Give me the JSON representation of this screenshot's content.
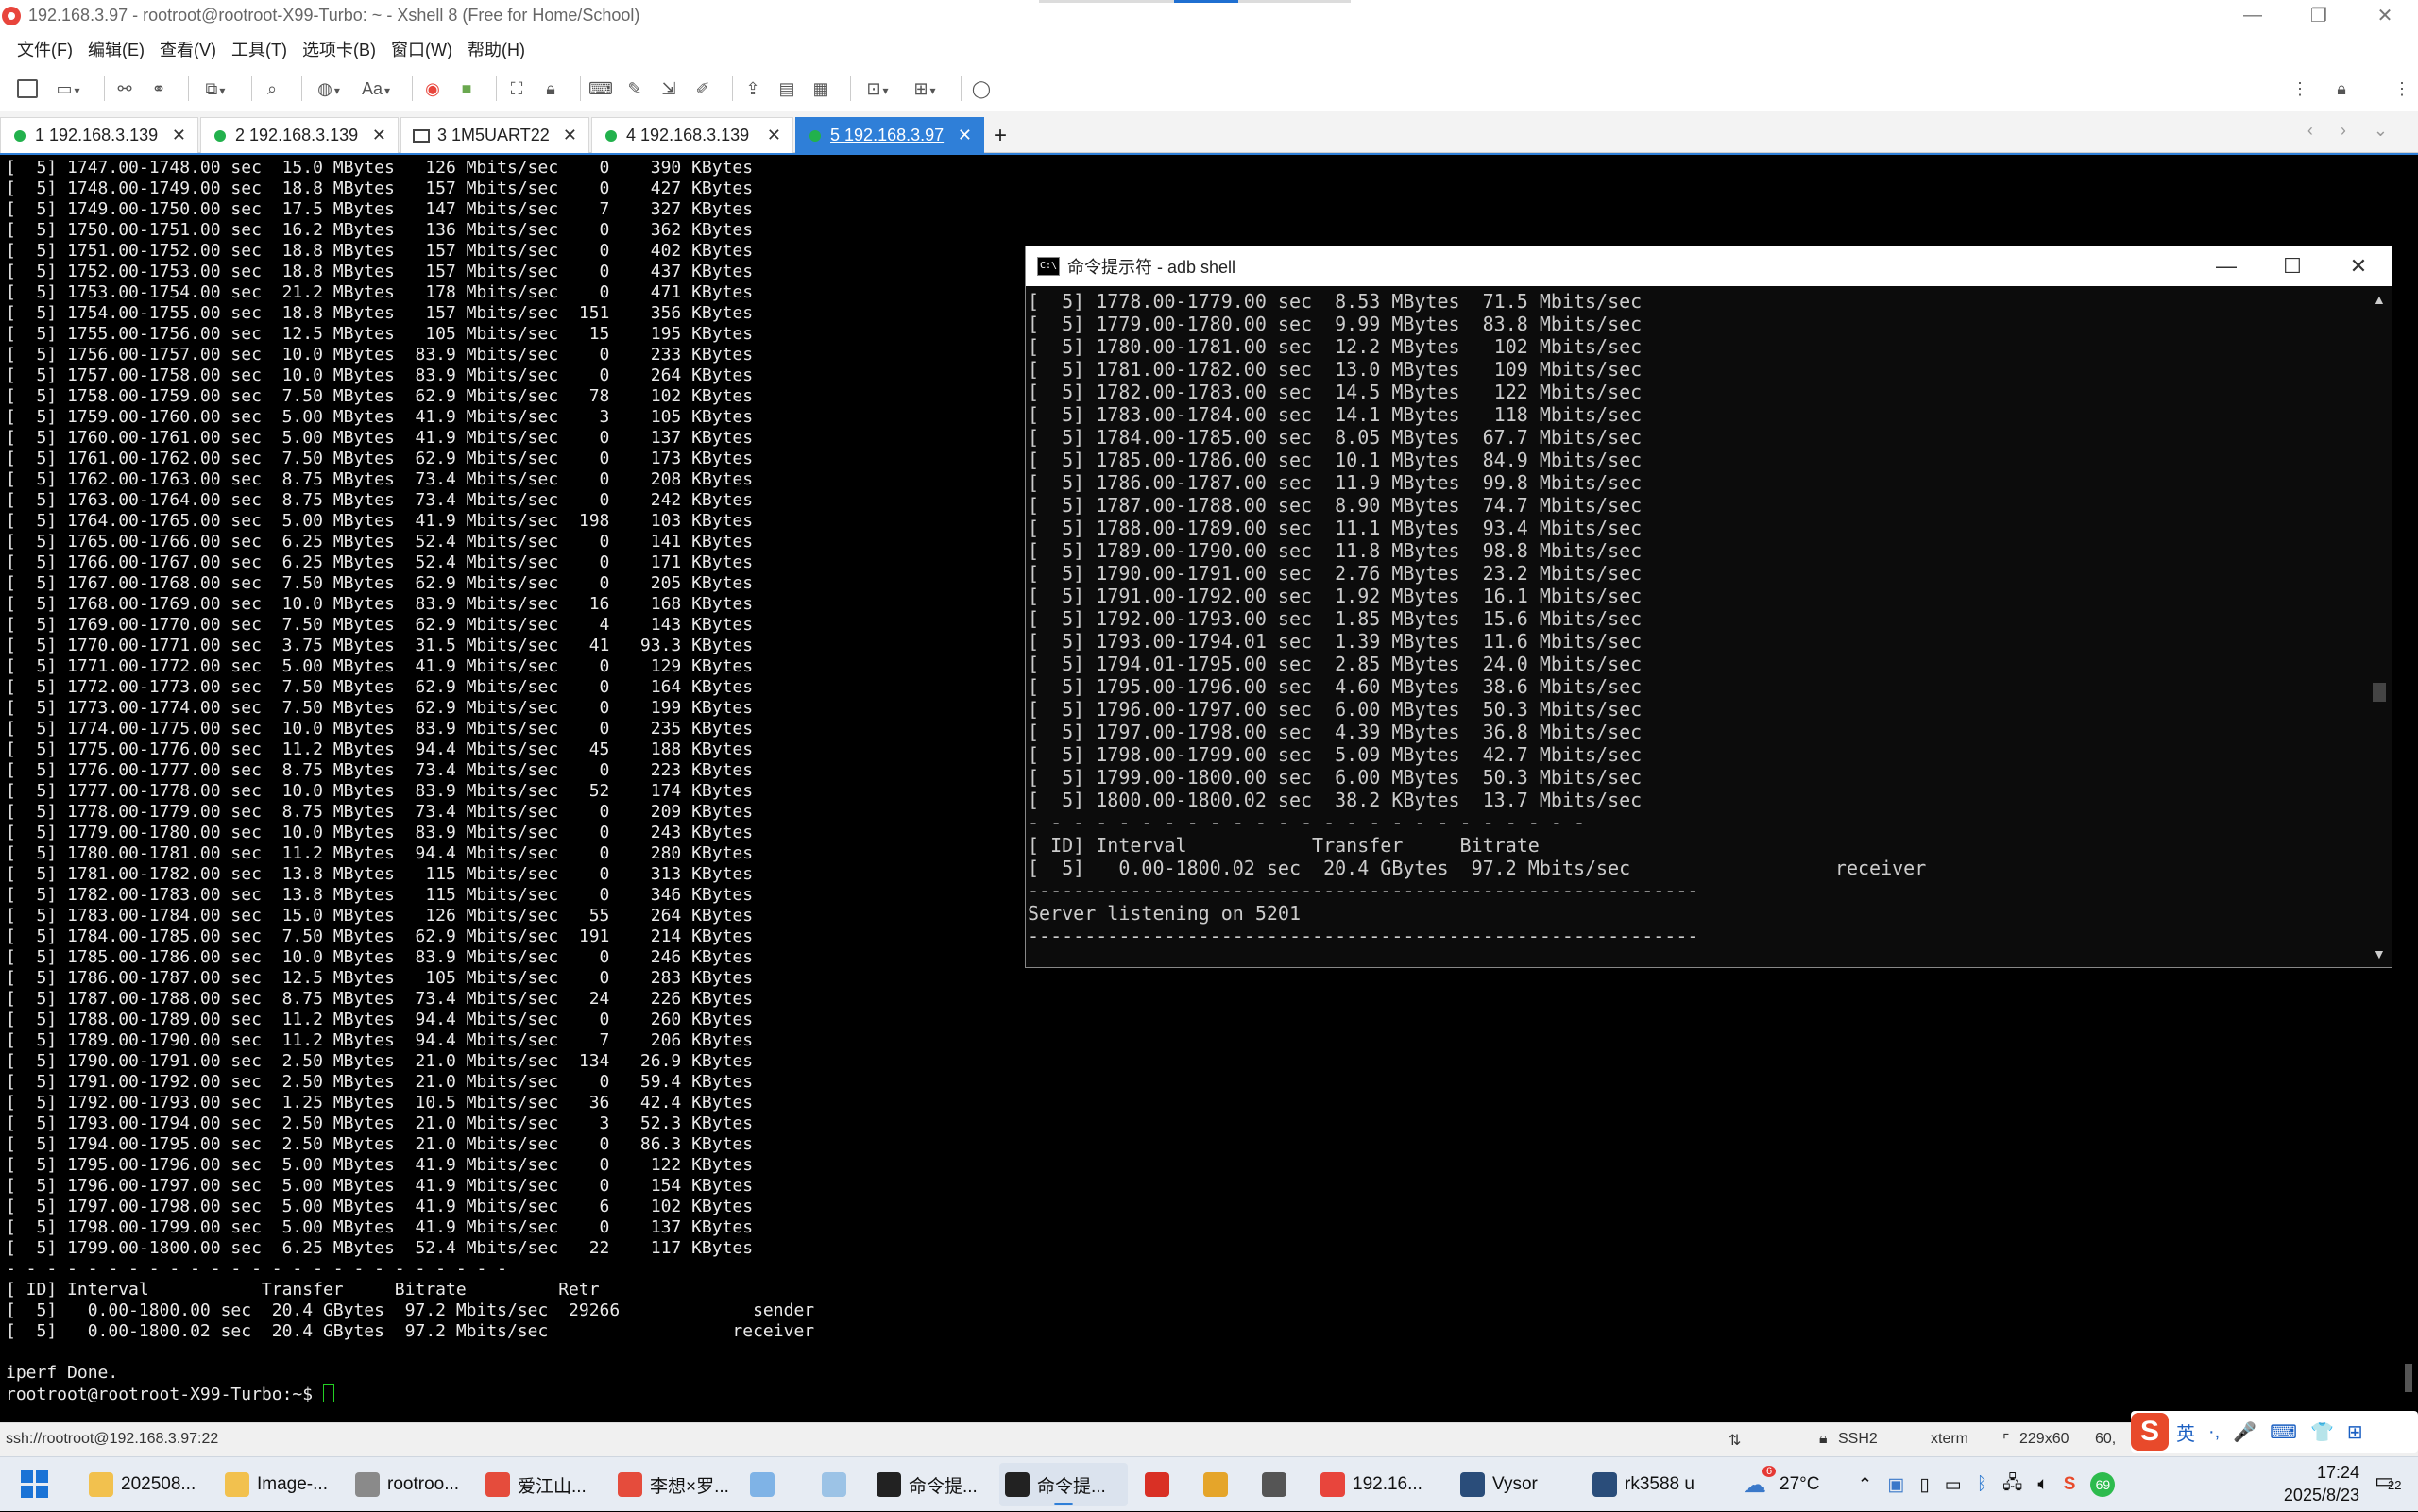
{
  "window": {
    "title": "192.168.3.97 - rootroot@rootroot-X99-Turbo: ~ - Xshell 8 (Free for Home/School)",
    "controls": [
      "—",
      "❐",
      "✕"
    ]
  },
  "menu": [
    "文件(F)",
    "编辑(E)",
    "查看(V)",
    "工具(T)",
    "选项卡(B)",
    "窗口(W)",
    "帮助(H)"
  ],
  "tabs": [
    {
      "num": "1",
      "label": "192.168.3.139",
      "icon": "green-dot"
    },
    {
      "num": "2",
      "label": "192.168.3.139",
      "icon": "green-dot"
    },
    {
      "num": "3",
      "label": "1M5UART22",
      "icon": "keyboard-icon"
    },
    {
      "num": "4",
      "label": "192.168.3.139",
      "icon": "green-dot"
    },
    {
      "num": "5",
      "label": "192.168.3.97",
      "icon": "green-dot",
      "active": true
    }
  ],
  "tab_close": "✕",
  "tab_add": "+",
  "tab_nav": "‹ › ⌄",
  "terminal": {
    "lines": [
      "[  5] 1747.00-1748.00 sec  15.0 MBytes   126 Mbits/sec    0    390 KBytes",
      "[  5] 1748.00-1749.00 sec  18.8 MBytes   157 Mbits/sec    0    427 KBytes",
      "[  5] 1749.00-1750.00 sec  17.5 MBytes   147 Mbits/sec    7    327 KBytes",
      "[  5] 1750.00-1751.00 sec  16.2 MBytes   136 Mbits/sec    0    362 KBytes",
      "[  5] 1751.00-1752.00 sec  18.8 MBytes   157 Mbits/sec    0    402 KBytes",
      "[  5] 1752.00-1753.00 sec  18.8 MBytes   157 Mbits/sec    0    437 KBytes",
      "[  5] 1753.00-1754.00 sec  21.2 MBytes   178 Mbits/sec    0    471 KBytes",
      "[  5] 1754.00-1755.00 sec  18.8 MBytes   157 Mbits/sec  151    356 KBytes",
      "[  5] 1755.00-1756.00 sec  12.5 MBytes   105 Mbits/sec   15    195 KBytes",
      "[  5] 1756.00-1757.00 sec  10.0 MBytes  83.9 Mbits/sec    0    233 KBytes",
      "[  5] 1757.00-1758.00 sec  10.0 MBytes  83.9 Mbits/sec    0    264 KBytes",
      "[  5] 1758.00-1759.00 sec  7.50 MBytes  62.9 Mbits/sec   78    102 KBytes",
      "[  5] 1759.00-1760.00 sec  5.00 MBytes  41.9 Mbits/sec    3    105 KBytes",
      "[  5] 1760.00-1761.00 sec  5.00 MBytes  41.9 Mbits/sec    0    137 KBytes",
      "[  5] 1761.00-1762.00 sec  7.50 MBytes  62.9 Mbits/sec    0    173 KBytes",
      "[  5] 1762.00-1763.00 sec  8.75 MBytes  73.4 Mbits/sec    0    208 KBytes",
      "[  5] 1763.00-1764.00 sec  8.75 MBytes  73.4 Mbits/sec    0    242 KBytes",
      "[  5] 1764.00-1765.00 sec  5.00 MBytes  41.9 Mbits/sec  198    103 KBytes",
      "[  5] 1765.00-1766.00 sec  6.25 MBytes  52.4 Mbits/sec    0    141 KBytes",
      "[  5] 1766.00-1767.00 sec  6.25 MBytes  52.4 Mbits/sec    0    171 KBytes",
      "[  5] 1767.00-1768.00 sec  7.50 MBytes  62.9 Mbits/sec    0    205 KBytes",
      "[  5] 1768.00-1769.00 sec  10.0 MBytes  83.9 Mbits/sec   16    168 KBytes",
      "[  5] 1769.00-1770.00 sec  7.50 MBytes  62.9 Mbits/sec    4    143 KBytes",
      "[  5] 1770.00-1771.00 sec  3.75 MBytes  31.5 Mbits/sec   41   93.3 KBytes",
      "[  5] 1771.00-1772.00 sec  5.00 MBytes  41.9 Mbits/sec    0    129 KBytes",
      "[  5] 1772.00-1773.00 sec  7.50 MBytes  62.9 Mbits/sec    0    164 KBytes",
      "[  5] 1773.00-1774.00 sec  7.50 MBytes  62.9 Mbits/sec    0    199 KBytes",
      "[  5] 1774.00-1775.00 sec  10.0 MBytes  83.9 Mbits/sec    0    235 KBytes",
      "[  5] 1775.00-1776.00 sec  11.2 MBytes  94.4 Mbits/sec   45    188 KBytes",
      "[  5] 1776.00-1777.00 sec  8.75 MBytes  73.4 Mbits/sec    0    223 KBytes",
      "[  5] 1777.00-1778.00 sec  10.0 MBytes  83.9 Mbits/sec   52    174 KBytes",
      "[  5] 1778.00-1779.00 sec  8.75 MBytes  73.4 Mbits/sec    0    209 KBytes",
      "[  5] 1779.00-1780.00 sec  10.0 MBytes  83.9 Mbits/sec    0    243 KBytes",
      "[  5] 1780.00-1781.00 sec  11.2 MBytes  94.4 Mbits/sec    0    280 KBytes",
      "[  5] 1781.00-1782.00 sec  13.8 MBytes   115 Mbits/sec    0    313 KBytes",
      "[  5] 1782.00-1783.00 sec  13.8 MBytes   115 Mbits/sec    0    346 KBytes",
      "[  5] 1783.00-1784.00 sec  15.0 MBytes   126 Mbits/sec   55    264 KBytes",
      "[  5] 1784.00-1785.00 sec  7.50 MBytes  62.9 Mbits/sec  191    214 KBytes",
      "[  5] 1785.00-1786.00 sec  10.0 MBytes  83.9 Mbits/sec    0    246 KBytes",
      "[  5] 1786.00-1787.00 sec  12.5 MBytes   105 Mbits/sec    0    283 KBytes",
      "[  5] 1787.00-1788.00 sec  8.75 MBytes  73.4 Mbits/sec   24    226 KBytes",
      "[  5] 1788.00-1789.00 sec  11.2 MBytes  94.4 Mbits/sec    0    260 KBytes",
      "[  5] 1789.00-1790.00 sec  11.2 MBytes  94.4 Mbits/sec    7    206 KBytes",
      "[  5] 1790.00-1791.00 sec  2.50 MBytes  21.0 Mbits/sec  134   26.9 KBytes",
      "[  5] 1791.00-1792.00 sec  2.50 MBytes  21.0 Mbits/sec    0   59.4 KBytes",
      "[  5] 1792.00-1793.00 sec  1.25 MBytes  10.5 Mbits/sec   36   42.4 KBytes",
      "[  5] 1793.00-1794.00 sec  2.50 MBytes  21.0 Mbits/sec    3   52.3 KBytes",
      "[  5] 1794.00-1795.00 sec  2.50 MBytes  21.0 Mbits/sec    0   86.3 KBytes",
      "[  5] 1795.00-1796.00 sec  5.00 MBytes  41.9 Mbits/sec    0    122 KBytes",
      "[  5] 1796.00-1797.00 sec  5.00 MBytes  41.9 Mbits/sec    0    154 KBytes",
      "[  5] 1797.00-1798.00 sec  5.00 MBytes  41.9 Mbits/sec    6    102 KBytes",
      "[  5] 1798.00-1799.00 sec  5.00 MBytes  41.9 Mbits/sec    0    137 KBytes",
      "[  5] 1799.00-1800.00 sec  6.25 MBytes  52.4 Mbits/sec   22    117 KBytes",
      "- - - - - - - - - - - - - - - - - - - - - - - - -",
      "[ ID] Interval           Transfer     Bitrate         Retr",
      "[  5]   0.00-1800.00 sec  20.4 GBytes  97.2 Mbits/sec  29266             sender",
      "[  5]   0.00-1800.02 sec  20.4 GBytes  97.2 Mbits/sec                  receiver",
      "",
      "iperf Done."
    ],
    "prompt": "rootroot@rootroot-X99-Turbo:~$ "
  },
  "cmd_window": {
    "title": "命令提示符 - adb  shell",
    "icon_text": "C:\\",
    "lines": [
      "[  5] 1778.00-1779.00 sec  8.53 MBytes  71.5 Mbits/sec",
      "[  5] 1779.00-1780.00 sec  9.99 MBytes  83.8 Mbits/sec",
      "[  5] 1780.00-1781.00 sec  12.2 MBytes   102 Mbits/sec",
      "[  5] 1781.00-1782.00 sec  13.0 MBytes   109 Mbits/sec",
      "[  5] 1782.00-1783.00 sec  14.5 MBytes   122 Mbits/sec",
      "[  5] 1783.00-1784.00 sec  14.1 MBytes   118 Mbits/sec",
      "[  5] 1784.00-1785.00 sec  8.05 MBytes  67.7 Mbits/sec",
      "[  5] 1785.00-1786.00 sec  10.1 MBytes  84.9 Mbits/sec",
      "[  5] 1786.00-1787.00 sec  11.9 MBytes  99.8 Mbits/sec",
      "[  5] 1787.00-1788.00 sec  8.90 MBytes  74.7 Mbits/sec",
      "[  5] 1788.00-1789.00 sec  11.1 MBytes  93.4 Mbits/sec",
      "[  5] 1789.00-1790.00 sec  11.8 MBytes  98.8 Mbits/sec",
      "[  5] 1790.00-1791.00 sec  2.76 MBytes  23.2 Mbits/sec",
      "[  5] 1791.00-1792.00 sec  1.92 MBytes  16.1 Mbits/sec",
      "[  5] 1792.00-1793.00 sec  1.85 MBytes  15.6 Mbits/sec",
      "[  5] 1793.00-1794.01 sec  1.39 MBytes  11.6 Mbits/sec",
      "[  5] 1794.01-1795.00 sec  2.85 MBytes  24.0 Mbits/sec",
      "[  5] 1795.00-1796.00 sec  4.60 MBytes  38.6 Mbits/sec",
      "[  5] 1796.00-1797.00 sec  6.00 MBytes  50.3 Mbits/sec",
      "[  5] 1797.00-1798.00 sec  4.39 MBytes  36.8 Mbits/sec",
      "[  5] 1798.00-1799.00 sec  5.09 MBytes  42.7 Mbits/sec",
      "[  5] 1799.00-1800.00 sec  6.00 MBytes  50.3 Mbits/sec",
      "[  5] 1800.00-1800.02 sec  38.2 KBytes  13.7 Mbits/sec",
      "- - - - - - - - - - - - - - - - - - - - - - - - -",
      "[ ID] Interval           Transfer     Bitrate",
      "[  5]   0.00-1800.02 sec  20.4 GBytes  97.2 Mbits/sec                  receiver",
      "-----------------------------------------------------------",
      "Server listening on 5201",
      "-----------------------------------------------------------"
    ]
  },
  "statusbar": {
    "connection": "ssh://rootroot@192.168.3.97:22",
    "protocol": "SSH2",
    "term": "xterm",
    "size": "229x60",
    "pos": "60,"
  },
  "ime": {
    "mode": "英",
    "items": [
      "·,",
      "🎤",
      "⌨",
      "👕",
      "⊞"
    ]
  },
  "taskbar": {
    "items": [
      {
        "label": "202508...",
        "color": "#f2c14e"
      },
      {
        "label": "Image-...",
        "color": "#f2c14e"
      },
      {
        "label": "rootroo...",
        "color": "#8a8a8a"
      },
      {
        "label": "爱江山...",
        "color": "#e54c3c"
      },
      {
        "label": "李想×罗...",
        "color": "#e54c3c"
      },
      {
        "label": "",
        "color": "#7fb3e6"
      },
      {
        "label": "",
        "color": "#9cc3e6"
      },
      {
        "label": "命令提...",
        "color": "#222"
      },
      {
        "label": "命令提...",
        "color": "#222"
      },
      {
        "label": "",
        "color": "#d93025"
      },
      {
        "label": "",
        "color": "#e5a52a"
      },
      {
        "label": "",
        "color": "#555"
      },
      {
        "label": "192.16...",
        "color": "#e8453c"
      },
      {
        "label": "Vysor",
        "color": "#2a4d7a"
      },
      {
        "label": "rk3588 u",
        "color": "#2a4d7a"
      }
    ],
    "weather": "27°C",
    "weather_badge": "6",
    "time": "17:24",
    "date": "2025/8/23",
    "battery_badge": "69",
    "notif_count": "22"
  }
}
